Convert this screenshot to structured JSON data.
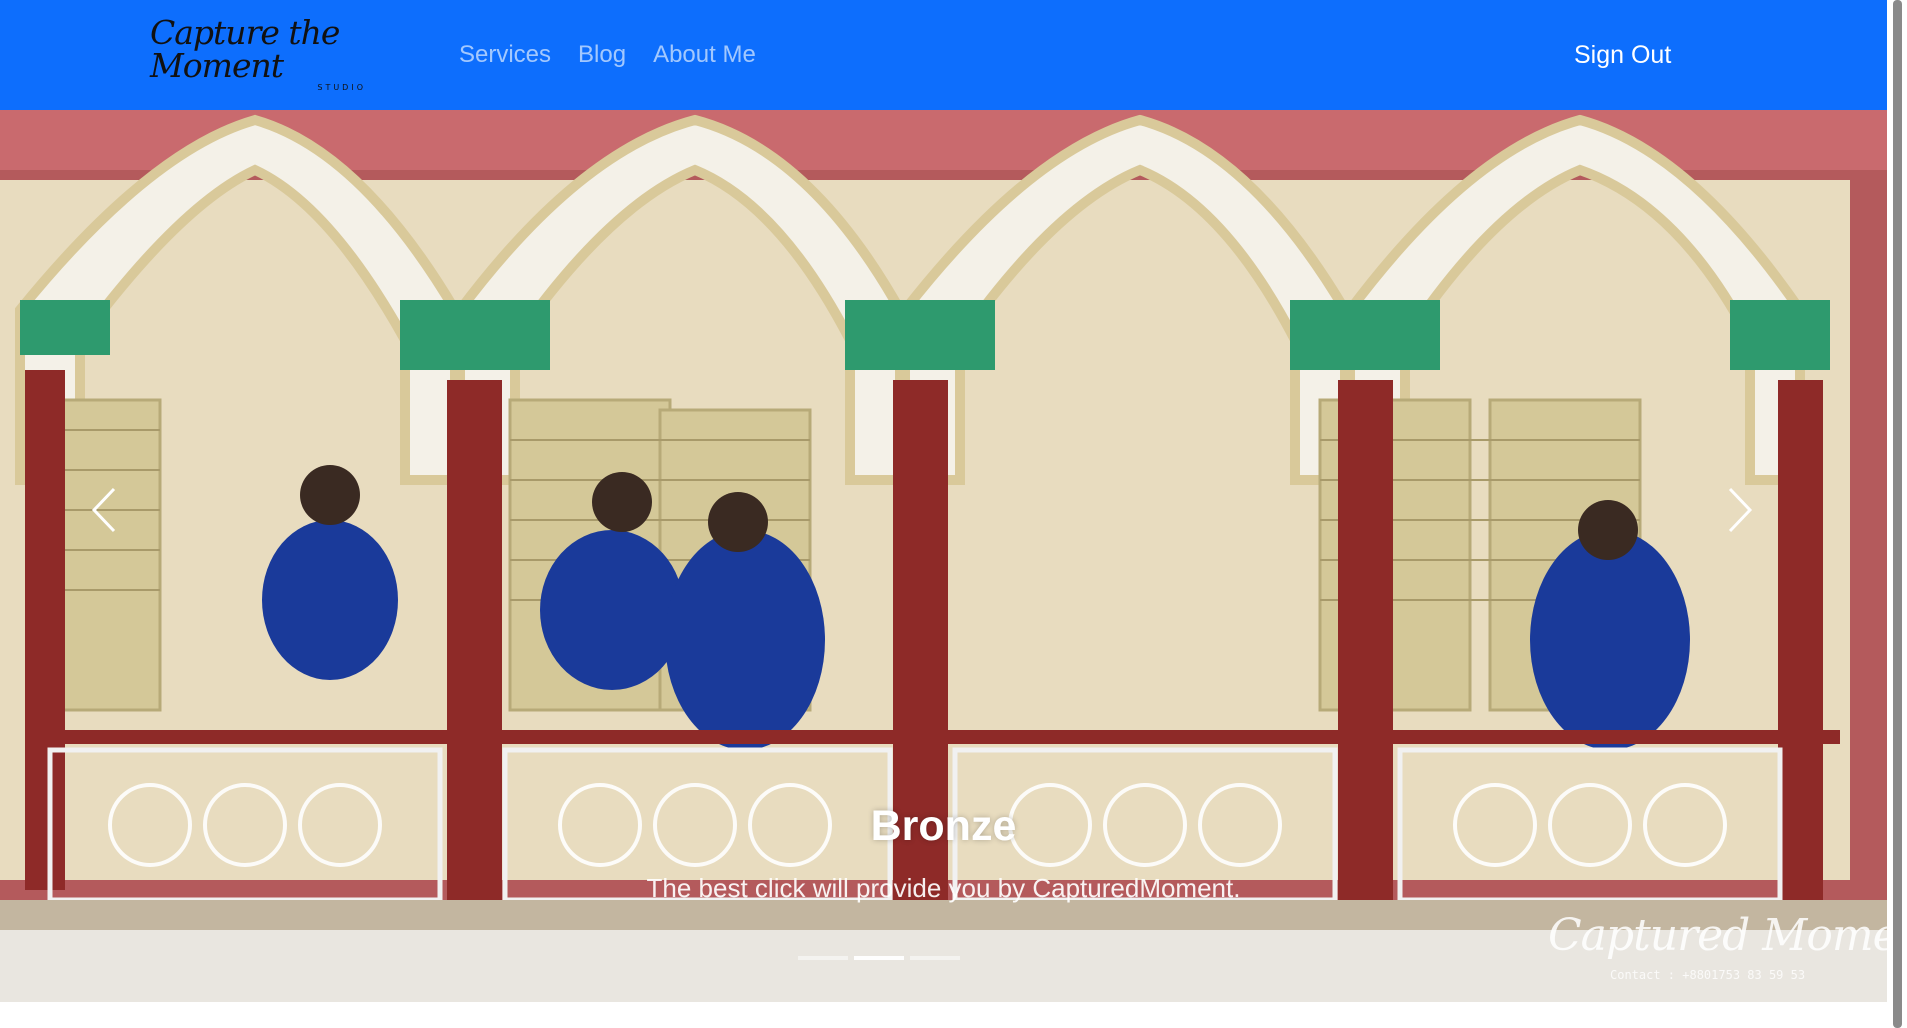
{
  "navbar": {
    "brand": {
      "line1": "Capture the Moment",
      "line2": "STUDIO"
    },
    "links": [
      "Services",
      "Blog",
      "About Me"
    ],
    "sign_out": "Sign Out",
    "color": "#0d6efd"
  },
  "carousel": {
    "slide_title": "Bronze",
    "slide_text": "The best click will provide you by CapturedMoment.",
    "watermark": {
      "text": "Captured Moments",
      "contact": "Contact : +8801753 83 59 53"
    },
    "prev_icon": "chevron-left-icon",
    "next_icon": "chevron-right-icon",
    "active_slide": 1,
    "slide_count": 3
  }
}
